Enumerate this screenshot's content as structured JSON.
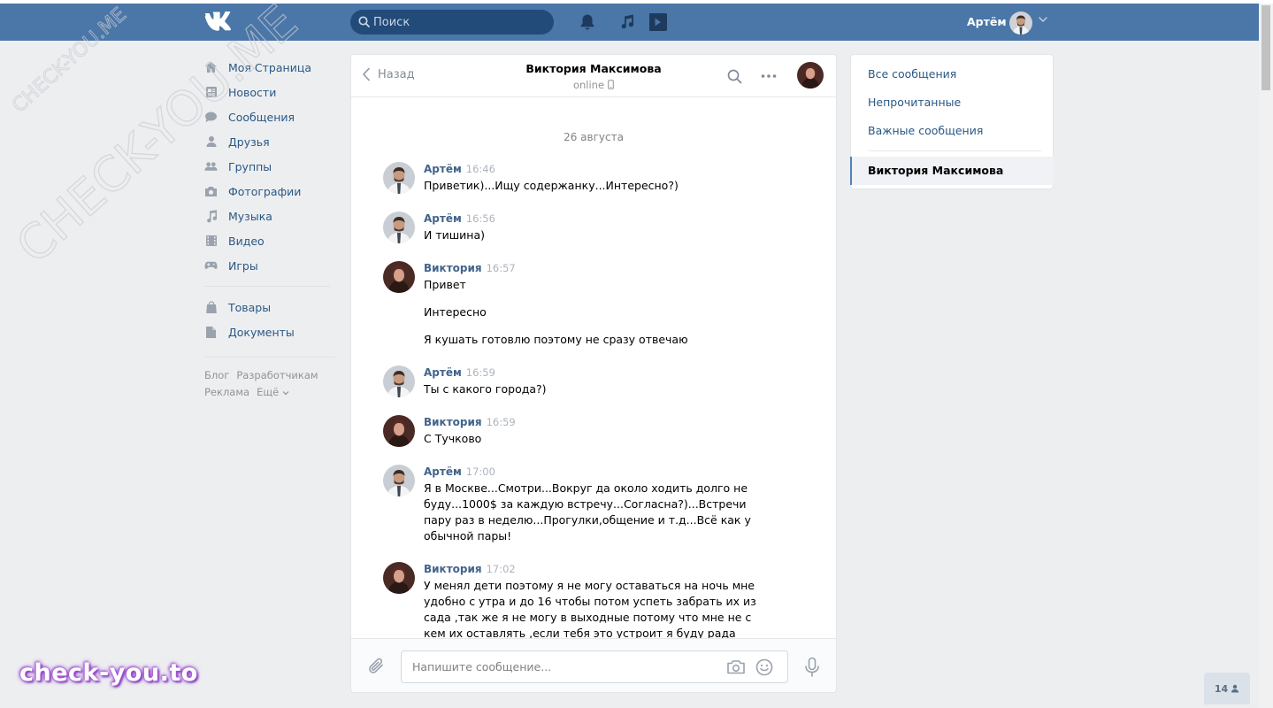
{
  "header": {
    "logo": "VK",
    "search_placeholder": "Поиск",
    "user_name": "Артём"
  },
  "left_nav": {
    "items": [
      {
        "label": "Моя Страница",
        "icon": "home-icon"
      },
      {
        "label": "Новости",
        "icon": "news-icon"
      },
      {
        "label": "Сообщения",
        "icon": "messages-icon"
      },
      {
        "label": "Друзья",
        "icon": "friends-icon"
      },
      {
        "label": "Группы",
        "icon": "groups-icon"
      },
      {
        "label": "Фотографии",
        "icon": "camera-icon"
      },
      {
        "label": "Музыка",
        "icon": "music-note-icon"
      },
      {
        "label": "Видео",
        "icon": "video-icon"
      },
      {
        "label": "Игры",
        "icon": "gamepad-icon"
      }
    ],
    "items2": [
      {
        "label": "Товары",
        "icon": "shopping-bag-icon"
      },
      {
        "label": "Документы",
        "icon": "document-icon"
      }
    ],
    "footer": [
      "Блог",
      "Разработчикам",
      "Реклама",
      "Ещё"
    ]
  },
  "chat": {
    "back_label": "Назад",
    "peer_name": "Виктория Максимова",
    "peer_status": "online",
    "date": "26 августа",
    "messages": [
      {
        "author": "Артём",
        "time": "16:46",
        "texts": [
          "Приветик)...Ищу содержанку...Интересно?)"
        ]
      },
      {
        "author": "Артём",
        "time": "16:56",
        "texts": [
          "И тишина)"
        ]
      },
      {
        "author": "Виктория",
        "time": "16:57",
        "texts": [
          "Привет",
          "Интересно",
          "Я кушать готовлю поэтому не сразу отвечаю"
        ]
      },
      {
        "author": "Артём",
        "time": "16:59",
        "texts": [
          "Ты с какого города?)"
        ]
      },
      {
        "author": "Виктория",
        "time": "16:59",
        "texts": [
          "С Тучково"
        ]
      },
      {
        "author": "Артём",
        "time": "17:00",
        "texts": [
          "Я в Москве...Смотри...Вокруг да около ходить долго не буду...1000$ за каждую встречу...Согласна?)...Встречи пару раз в неделю...Прогулки,общение и т.д...Всё как у обычной пары!"
        ]
      },
      {
        "author": "Виктория",
        "time": "17:02",
        "texts": [
          "У менял дети поэтому я не могу оставаться на ночь мне удобно с утра и до 16 чтобы потом успеть забрать их из сада ,так же я не могу в выходные потому что мне не с кем их оставлять ,если тебя это устроит я буду рада продолжить общения если нет то приятно было познакомиться"
        ]
      }
    ],
    "compose_placeholder": "Напишите сообщение..."
  },
  "right_panel": {
    "items": [
      "Все сообщения",
      "Непрочитанные",
      "Важные сообщения"
    ],
    "active": "Виктория Максимова"
  },
  "online_count": "14",
  "watermarks": {
    "diagonal": "CHECK-YOU.ME",
    "bottom": "check-you.to"
  },
  "colors": {
    "header": "#4a76a8",
    "link": "#2a5885",
    "author": "#42648b",
    "background": "#edeef0"
  }
}
